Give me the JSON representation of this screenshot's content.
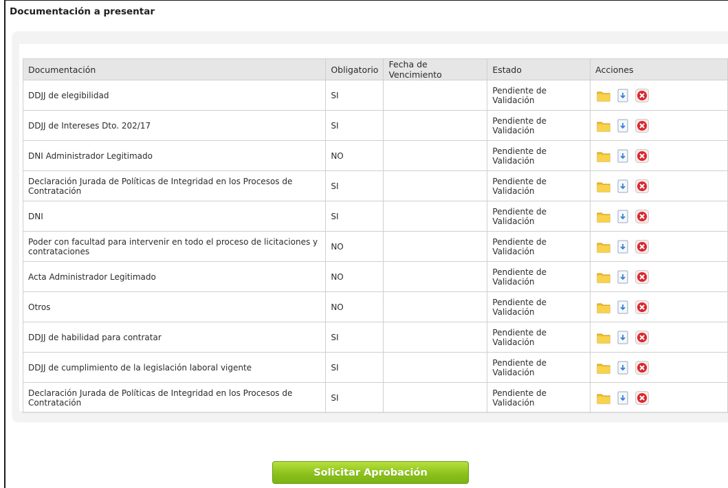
{
  "section": {
    "title": "Documentación a presentar"
  },
  "table": {
    "headers": {
      "documentacion": "Documentación",
      "obligatorio": "Obligatorio",
      "vencimiento": "Fecha de Vencimiento",
      "estado": "Estado",
      "acciones": "Acciones"
    },
    "rows": [
      {
        "doc": "DDJJ de elegibilidad",
        "obligatorio": "SI",
        "vencimiento": "",
        "estado": "Pendiente de Validación"
      },
      {
        "doc": "DDJJ de Intereses Dto. 202/17",
        "obligatorio": "SI",
        "vencimiento": "",
        "estado": "Pendiente de Validación"
      },
      {
        "doc": "DNI Administrador Legitimado",
        "obligatorio": "NO",
        "vencimiento": "",
        "estado": "Pendiente de Validación"
      },
      {
        "doc": "Declaración Jurada de Políticas de Integridad en los Procesos de Contratación",
        "obligatorio": "SI",
        "vencimiento": "",
        "estado": "Pendiente de Validación"
      },
      {
        "doc": "DNI",
        "obligatorio": "SI",
        "vencimiento": "",
        "estado": "Pendiente de Validación"
      },
      {
        "doc": "Poder con facultad para intervenir en todo el proceso de licitaciones y contrataciones",
        "obligatorio": "NO",
        "vencimiento": "",
        "estado": "Pendiente de Validación"
      },
      {
        "doc": "Acta Administrador Legitimado",
        "obligatorio": "NO",
        "vencimiento": "",
        "estado": "Pendiente de Validación"
      },
      {
        "doc": "Otros",
        "obligatorio": "NO",
        "vencimiento": "",
        "estado": "Pendiente de Validación"
      },
      {
        "doc": "DDJJ de habilidad para contratar",
        "obligatorio": "SI",
        "vencimiento": "",
        "estado": "Pendiente de Validación"
      },
      {
        "doc": "DDJJ de cumplimiento de la legislación laboral vigente",
        "obligatorio": "SI",
        "vencimiento": "",
        "estado": "Pendiente de Validación"
      },
      {
        "doc": "Declaración Jurada de Políticas de Integridad en los Procesos de Contratación",
        "obligatorio": "SI",
        "vencimiento": "",
        "estado": "Pendiente de Validación"
      }
    ],
    "action_icons": [
      "folder-icon",
      "download-icon",
      "delete-icon"
    ]
  },
  "submit": {
    "label": "Solicitar Aprobación"
  },
  "colors": {
    "accent_green": "#8cc21b",
    "header_bg": "#e6e6e6",
    "delete_red": "#d9272e",
    "folder_yellow": "#f2c230"
  }
}
